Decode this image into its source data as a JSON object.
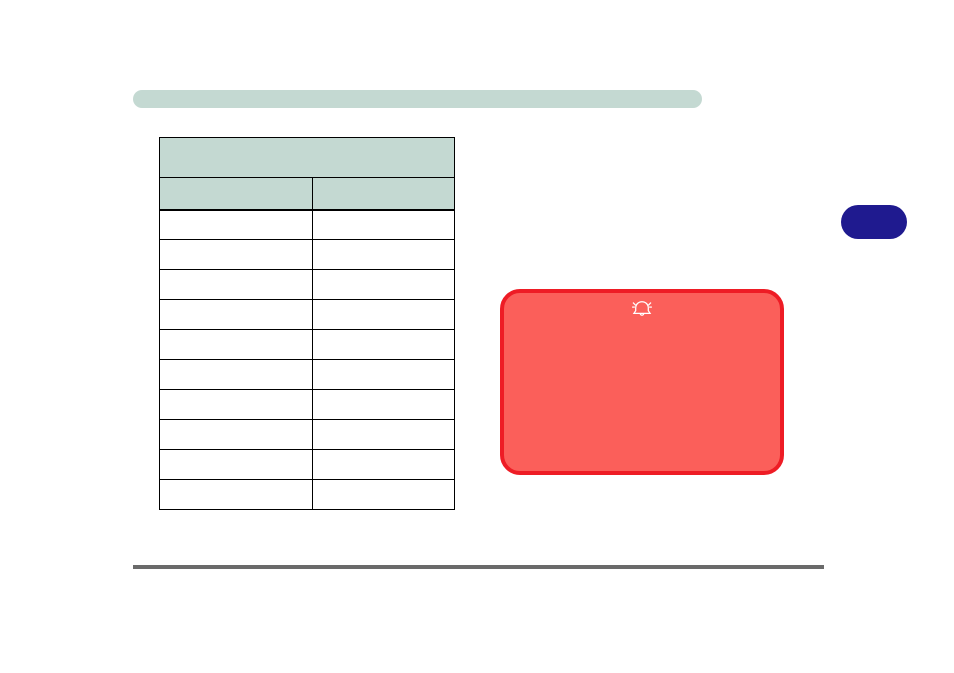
{
  "header": {
    "title": ""
  },
  "table": {
    "merged_header": "",
    "col1_header": "",
    "col2_header": "",
    "rows": [
      {
        "c1": "",
        "c2": ""
      },
      {
        "c1": "",
        "c2": ""
      },
      {
        "c1": "",
        "c2": ""
      },
      {
        "c1": "",
        "c2": ""
      },
      {
        "c1": "",
        "c2": ""
      },
      {
        "c1": "",
        "c2": ""
      },
      {
        "c1": "",
        "c2": ""
      },
      {
        "c1": "",
        "c2": ""
      },
      {
        "c1": "",
        "c2": ""
      },
      {
        "c1": "",
        "c2": ""
      }
    ]
  },
  "alert": {
    "text": ""
  },
  "button": {
    "label": ""
  },
  "colors": {
    "header_bg": "#c4d9d2",
    "alert_bg": "#fb5f5a",
    "alert_border": "#ee1c25",
    "button_bg": "#1f1a8f",
    "rule": "#6a6a6a"
  }
}
